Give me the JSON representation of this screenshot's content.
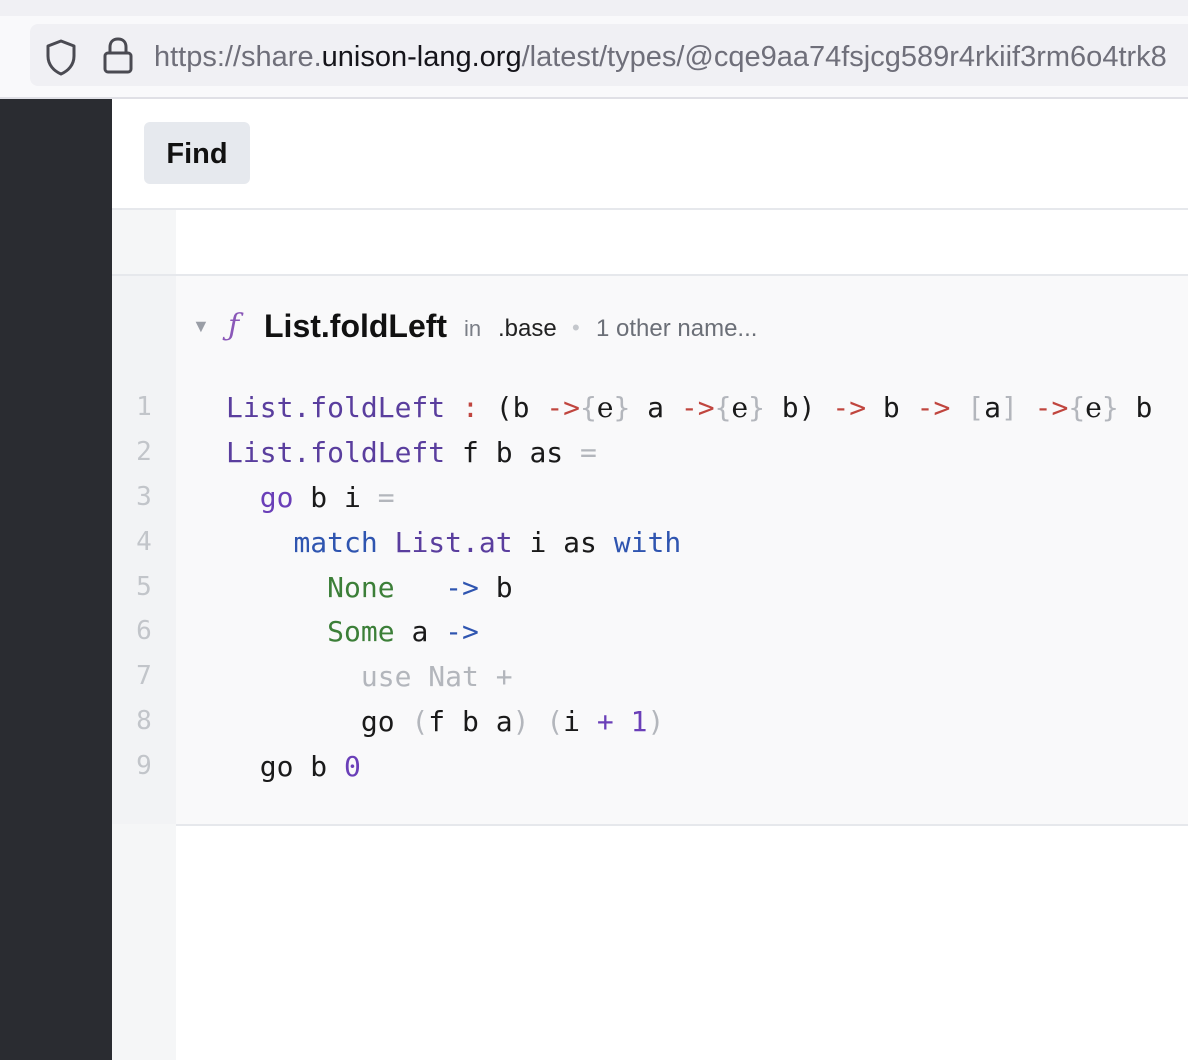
{
  "browser": {
    "url_prefix": "https://share.",
    "url_host": "unison-lang.org",
    "url_path": "/latest/types/@cqe9aa74fsjcg589r4rkiif3rm6o4trk8"
  },
  "toolbar": {
    "find_label": "Find"
  },
  "definition": {
    "caret": "▼",
    "kind_icon": "ƒ",
    "name": "List.foldLeft",
    "in_label": "in",
    "namespace": ".base",
    "separator": "•",
    "other_names": "1 other name..."
  },
  "code": {
    "line_numbers": [
      "1",
      "2",
      "3",
      "4",
      "5",
      "6",
      "7",
      "8",
      "9"
    ]
  },
  "colors": {
    "sidebar": "#2a2c31",
    "name": "#5a3e9e",
    "arrow": "#c0453e",
    "constructor": "#3c7f38",
    "keyword": "#2f55b0"
  }
}
